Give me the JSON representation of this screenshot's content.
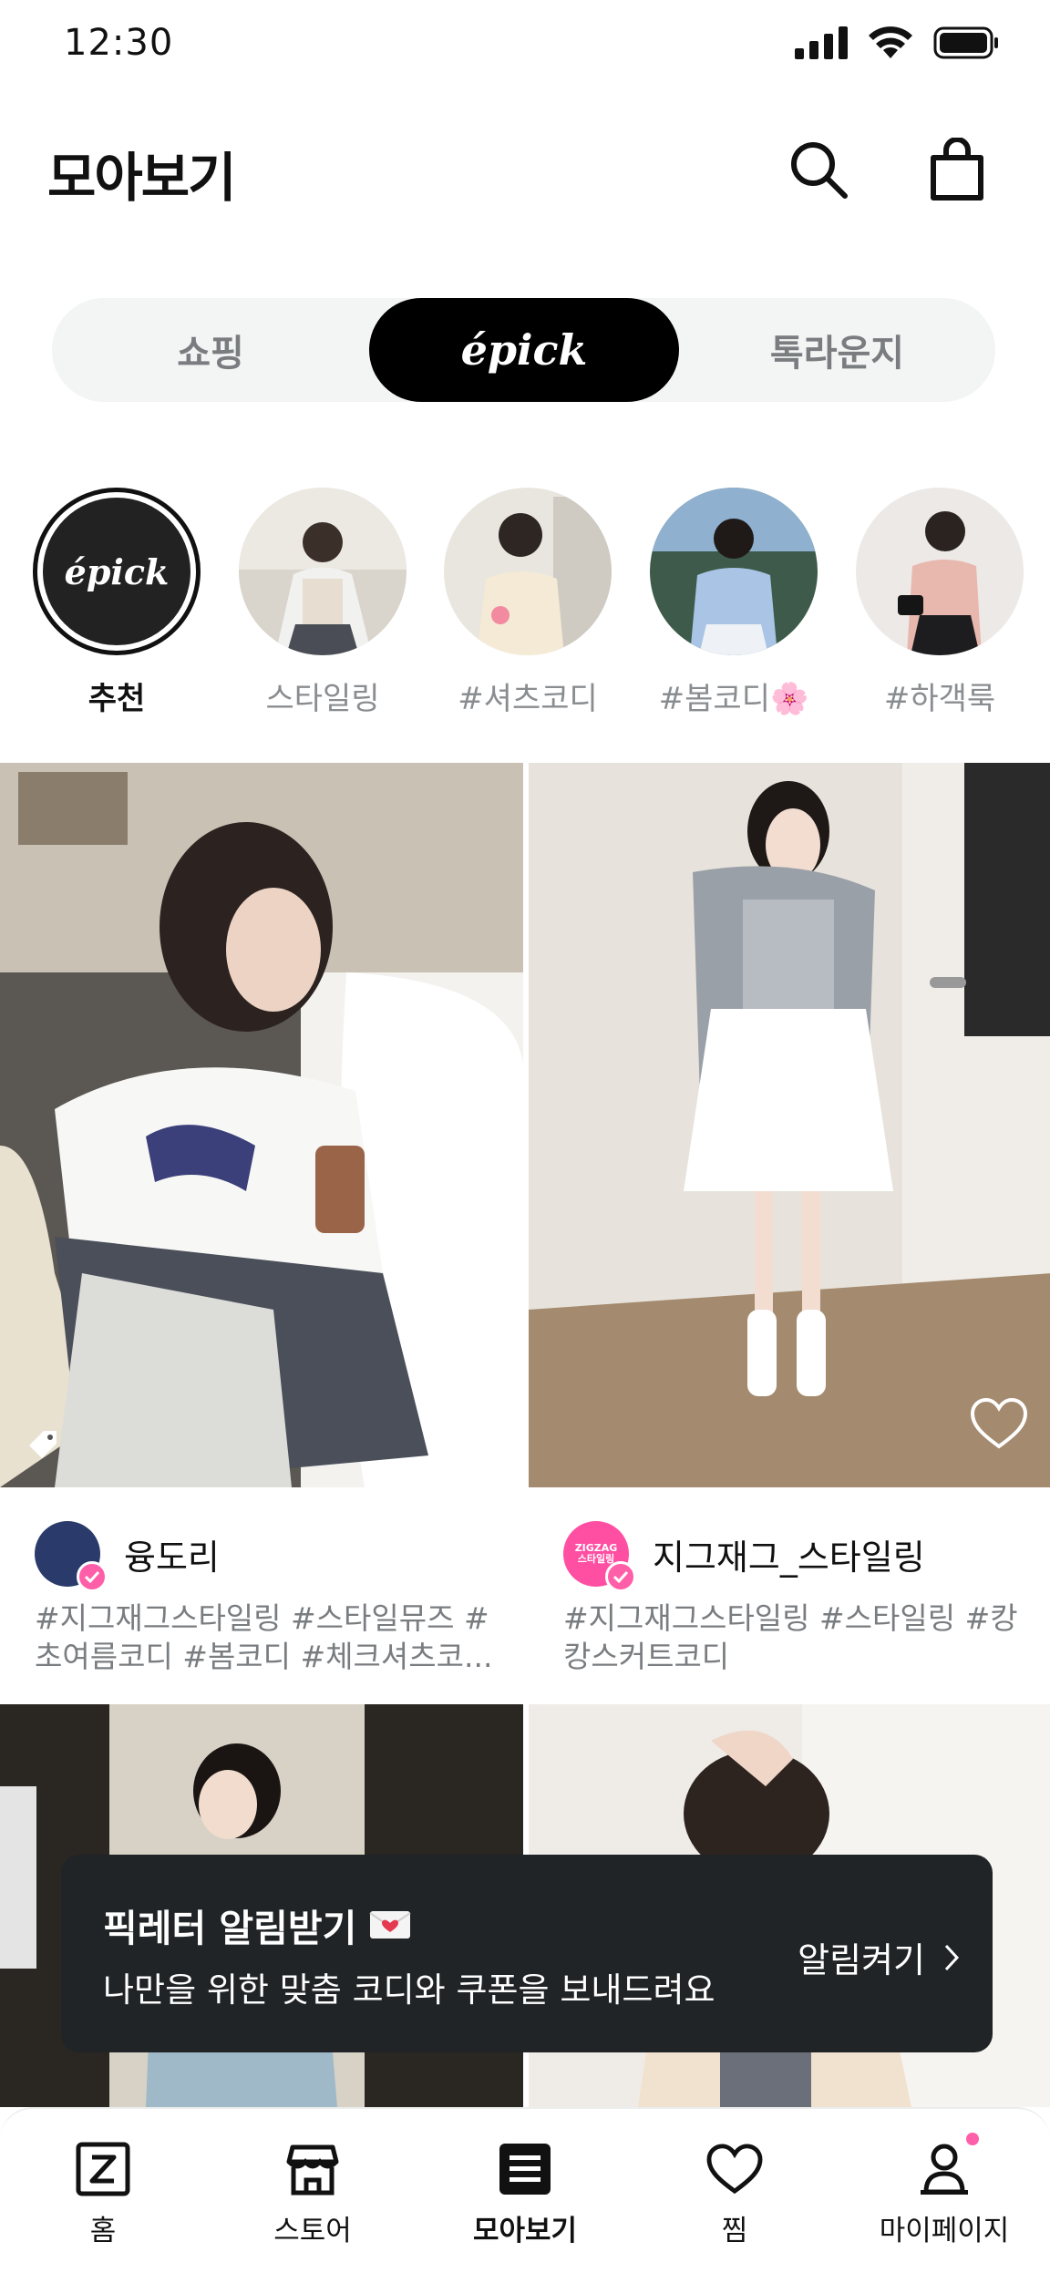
{
  "status_bar": {
    "time": "12:30"
  },
  "header": {
    "title": "모아보기"
  },
  "segment_tabs": [
    {
      "label": "쇼핑"
    },
    {
      "label": "épick"
    },
    {
      "label": "톡라운지"
    }
  ],
  "stories": [
    {
      "label": "추천",
      "badge": "épick"
    },
    {
      "label": "스타일링"
    },
    {
      "label": "#셔츠코디"
    },
    {
      "label": "#봄코디🌸"
    },
    {
      "label": "#하객룩"
    }
  ],
  "feed": [
    {
      "author": "융도리",
      "caption": "#지그재그스타일링 #스타일뮤즈 #초여름코디 #봄코디 #체크셔츠코..."
    },
    {
      "author": "지그재그_스타일링",
      "avatar_text": "ZIGZAG 스타일링",
      "caption": "#지그재그스타일링 #스타일링 #캉캉스커트코디"
    }
  ],
  "toast": {
    "title": "픽레터 알림받기",
    "subtitle": "나만을 위한 맞춤 코디와 쿠폰을 보내드려요",
    "action": "알림켜기"
  },
  "bottom_nav": [
    {
      "label": "홈",
      "icon": "home-z-icon"
    },
    {
      "label": "스토어",
      "icon": "store-icon"
    },
    {
      "label": "모아보기",
      "icon": "feed-icon"
    },
    {
      "label": "찜",
      "icon": "heart-icon"
    },
    {
      "label": "마이페이지",
      "icon": "profile-icon"
    }
  ],
  "colors": {
    "accent": "#ff5fa8",
    "toast_bg": "#212427",
    "segment_bg": "#f3f4f4"
  }
}
